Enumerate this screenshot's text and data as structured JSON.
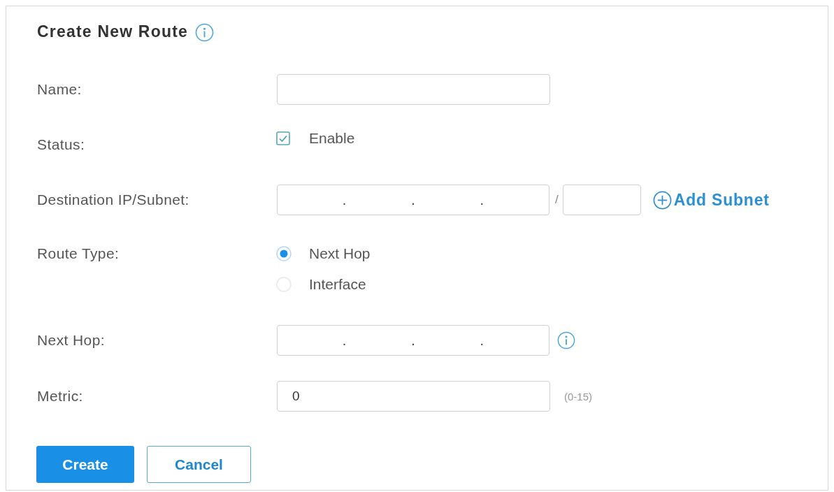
{
  "form": {
    "title": "Create New Route",
    "info": true,
    "fields": [
      {
        "kind": "text",
        "label": "Name:"
      },
      {
        "kind": "checkbox",
        "label": "Status:",
        "option": "Enable",
        "checked": true
      },
      {
        "kind": "ip_subnet",
        "label": "Destination IP/Subnet:",
        "separators": [
          ".",
          ".",
          "."
        ],
        "slash": "/",
        "action": "Add Subnet"
      },
      {
        "kind": "radio",
        "label": "Route Type:",
        "options": [
          {
            "label": "Next Hop",
            "selected": true
          },
          {
            "label": "Interface",
            "selected": false
          }
        ]
      },
      {
        "kind": "ip",
        "label": "Next Hop:",
        "separators": [
          ".",
          ".",
          "."
        ],
        "info": true
      },
      {
        "kind": "text",
        "label": "Metric:",
        "value": "0",
        "hint": "(0-15)"
      }
    ]
  },
  "buttons": [
    {
      "label": "Create",
      "kind": "primary"
    },
    {
      "label": "Cancel",
      "kind": "secondary"
    }
  ]
}
